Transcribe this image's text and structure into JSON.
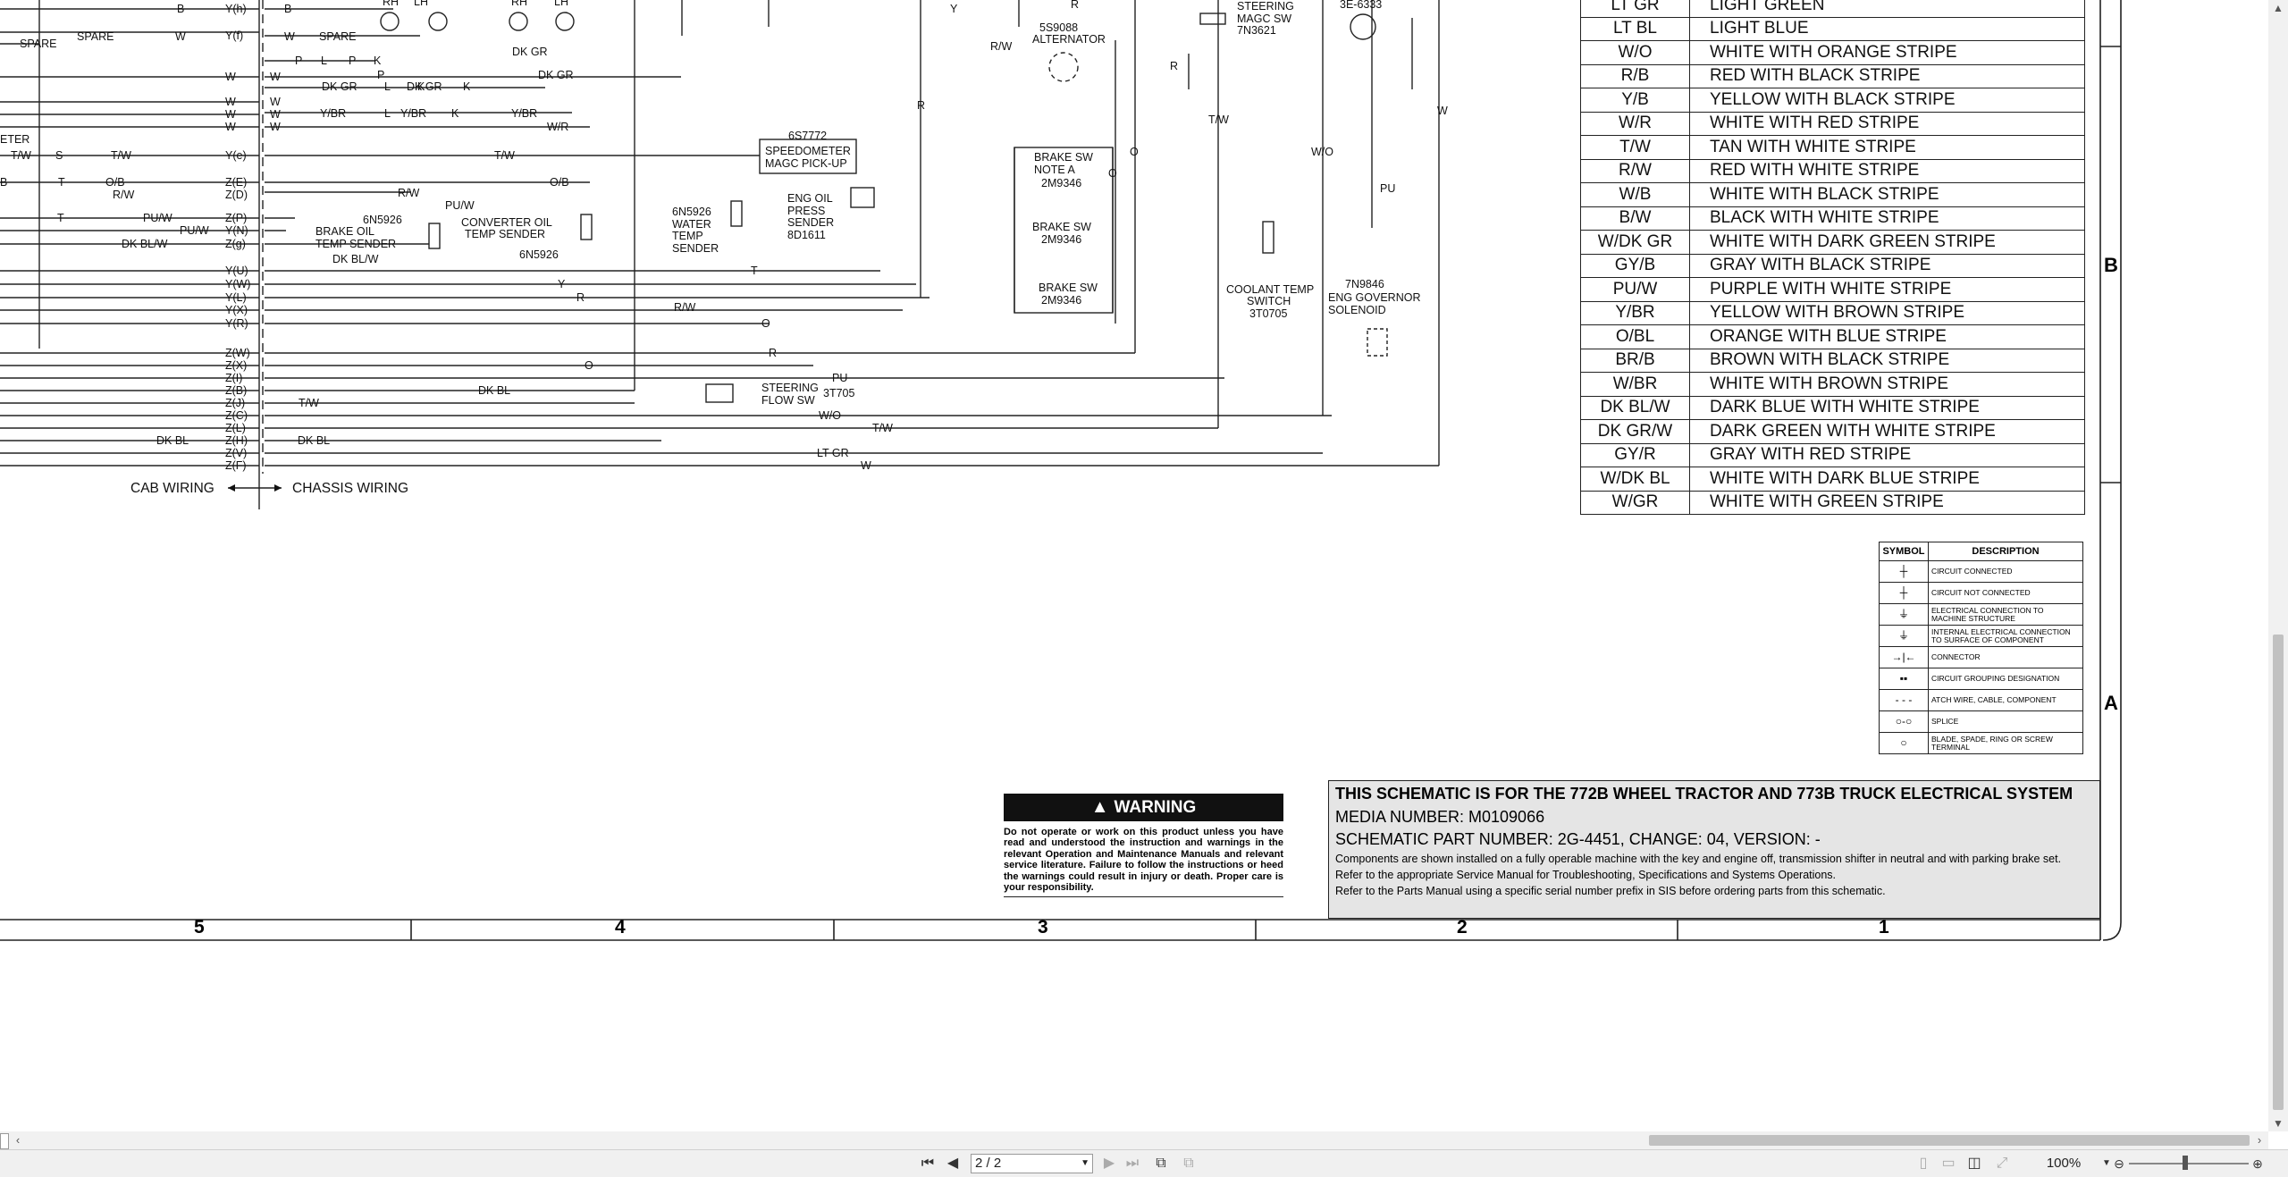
{
  "schematic": {
    "wire_labels": {
      "spare_a": "SPARE",
      "spare_b": "SPARE",
      "spare_c": "SPARE",
      "b1": "B",
      "b2": "B",
      "b3": "B",
      "w1": "W",
      "w2": "W",
      "w3": "W",
      "w4": "W",
      "w5": "W",
      "w6": "W",
      "w7": "W",
      "p1": "P",
      "p2": "P",
      "p3": "P",
      "l1": "L",
      "l2": "L",
      "l3": "L",
      "k1": "K",
      "k2": "K",
      "k3": "K",
      "k4": "K",
      "dkgr1": "DK GR",
      "dkgr2": "DK GR",
      "dkgr3": "DK GR",
      "dkgr4": "DK GR",
      "ybr1": "Y/BR",
      "ybr2": "Y/BR",
      "ybr3": "Y/BR",
      "wr1": "W/R",
      "eter": "ETER",
      "tw1": "T/W",
      "tw2": "T/W",
      "tw3": "T/W",
      "tw4": "T/W",
      "tw5": "T/W",
      "tw6": "T/W",
      "s1": "S",
      "t1": "T",
      "t2": "T",
      "t3": "T",
      "ob1": "O/B",
      "ob2": "O/B",
      "rw1": "R/W",
      "rw2": "R/W",
      "rw3": "R/W",
      "rw4": "R/W",
      "puw1": "PU/W",
      "puw2": "PU/W",
      "puw3": "PU/W",
      "dkblw1": "DK BL/W",
      "dkblw2": "DK BL/W",
      "y1": "Y",
      "y2": "Y",
      "r1": "R",
      "r2": "R",
      "r3": "R",
      "r4": "R",
      "r5": "R",
      "o1": "O",
      "o2": "O",
      "o3": "O",
      "o4": "O",
      "dkbl1": "DK BL",
      "dkbl2": "DK BL",
      "dkbl3": "DK BL",
      "pu1": "PU",
      "pu2": "PU",
      "wo1": "W/O",
      "wo2": "W/O",
      "ltgr": "LT GR",
      "w8": "W",
      "rh1": "RH",
      "lh1": "LH",
      "rh2": "RH",
      "lh2": "LH",
      "cab": "CAB WIRING",
      "chassis": "CHASSIS WIRING"
    },
    "connector_pins": [
      "Y(h)",
      "Y(f)",
      "W",
      "W",
      "W",
      "W",
      "Y(e)",
      "Z(E)",
      "Z(D)",
      "Z(P)",
      "Y(N)",
      "Z(g)",
      "Y(U)",
      "Y(W)",
      "Y(L)",
      "Y(X)",
      "Y(R)",
      "Z(W)",
      "Z(X)",
      "Z(I)",
      "Z(B)",
      "Z(J)",
      "Z(C)",
      "Z(L)",
      "Z(H)",
      "Z(V)",
      "Z(F)"
    ],
    "components": {
      "speedometer_pn": "6S7772",
      "speedometer_l1": "SPEEDOMETER",
      "speedometer_l2": "MAGC PICK-UP",
      "brake_oil_pn": "6N5926",
      "brake_oil_l1": "BRAKE OIL",
      "brake_oil_l2": "TEMP SENDER",
      "converter_l1": "CONVERTER OIL",
      "converter_l2": "TEMP SENDER",
      "converter_pn": "6N5926",
      "water_pn": "6N5926",
      "water_l1": "WATER",
      "water_l2": "TEMP",
      "water_l3": "SENDER",
      "engoil_l1": "ENG OIL",
      "engoil_l2": "PRESS",
      "engoil_l3": "SENDER",
      "engoil_pn": "8D1611",
      "alternator_pn": "5S9088",
      "alternator_l1": "ALTERNATOR",
      "brakesw1_l1": "BRAKE SW",
      "brakesw1_l2": "NOTE A",
      "brakesw1_pn": "2M9346",
      "brakesw2_l1": "BRAKE SW",
      "brakesw2_pn": "2M9346",
      "brakesw3_l1": "BRAKE SW",
      "brakesw3_pn": "2M9346",
      "steering_magc_l1": "STEERING",
      "steering_magc_l2": "MAGC SW",
      "steering_magc_pn": "7N3621",
      "steering_flow_l1": "STEERING",
      "steering_flow_l2": "FLOW SW",
      "steering_flow_pn": "3T705",
      "coolant_l1": "COOLANT TEMP",
      "coolant_l2": "SWITCH",
      "coolant_pn": "3T0705",
      "governor_pn": "7N9846",
      "governor_l1": "ENG GOVERNOR",
      "governor_l2": "SOLENOID",
      "part_3e": "3E-6333"
    }
  },
  "color_table": [
    {
      "code": "LT GR",
      "desc": "LIGHT GREEN"
    },
    {
      "code": "LT BL",
      "desc": "LIGHT BLUE"
    },
    {
      "code": "W/O",
      "desc": "WHITE WITH ORANGE STRIPE"
    },
    {
      "code": "R/B",
      "desc": "RED WITH BLACK STRIPE"
    },
    {
      "code": "Y/B",
      "desc": "YELLOW WITH BLACK STRIPE"
    },
    {
      "code": "W/R",
      "desc": "WHITE WITH RED STRIPE"
    },
    {
      "code": "T/W",
      "desc": "TAN WITH WHITE STRIPE"
    },
    {
      "code": "R/W",
      "desc": "RED WITH WHITE STRIPE"
    },
    {
      "code": "W/B",
      "desc": "WHITE WITH BLACK STRIPE"
    },
    {
      "code": "B/W",
      "desc": "BLACK WITH WHITE STRIPE"
    },
    {
      "code": "W/DK GR",
      "desc": "WHITE WITH DARK GREEN STRIPE"
    },
    {
      "code": "GY/B",
      "desc": "GRAY WITH BLACK STRIPE"
    },
    {
      "code": "PU/W",
      "desc": "PURPLE WITH WHITE STRIPE"
    },
    {
      "code": "Y/BR",
      "desc": "YELLOW WITH BROWN STRIPE"
    },
    {
      "code": "O/BL",
      "desc": "ORANGE WITH BLUE STRIPE"
    },
    {
      "code": "BR/B",
      "desc": "BROWN WITH BLACK STRIPE"
    },
    {
      "code": "W/BR",
      "desc": "WHITE WITH BROWN STRIPE"
    },
    {
      "code": "DK BL/W",
      "desc": "DARK BLUE WITH WHITE STRIPE"
    },
    {
      "code": "DK GR/W",
      "desc": "DARK GREEN WITH WHITE STRIPE"
    },
    {
      "code": "GY/R",
      "desc": "GRAY WITH RED STRIPE"
    },
    {
      "code": "W/DK BL",
      "desc": "WHITE WITH DARK BLUE STRIPE"
    },
    {
      "code": "W/GR",
      "desc": "WHITE WITH GREEN STRIPE"
    }
  ],
  "symbol_table": {
    "header_symbol": "SYMBOL",
    "header_desc": "DESCRIPTION",
    "rows": [
      {
        "symbol": "┼",
        "icon": "circuit-connected-icon",
        "desc": "CIRCUIT CONNECTED"
      },
      {
        "symbol": "┼",
        "icon": "circuit-not-connected-icon",
        "desc": "CIRCUIT NOT CONNECTED"
      },
      {
        "symbol": "⏚",
        "icon": "machine-ground-icon",
        "desc": "ELECTRICAL CONNECTION TO MACHINE STRUCTURE"
      },
      {
        "symbol": "⏚",
        "icon": "component-ground-icon",
        "desc": "INTERNAL ELECTRICAL CONNECTION TO SURFACE OF COMPONENT"
      },
      {
        "symbol": "→|←",
        "icon": "connector-icon",
        "desc": "CONNECTOR"
      },
      {
        "symbol": "▪▪",
        "icon": "circuit-grouping-icon",
        "desc": "CIRCUIT GROUPING DESIGNATION"
      },
      {
        "symbol": "- - -",
        "icon": "dashed-line-icon",
        "desc": "ATCH WIRE, CABLE, COMPONENT"
      },
      {
        "symbol": "○-○",
        "icon": "splice-icon",
        "desc": "SPLICE"
      },
      {
        "symbol": "○",
        "icon": "terminal-icon",
        "desc": "BLADE, SPADE, RING OR SCREW TERMINAL"
      }
    ]
  },
  "title_block": {
    "title": "THIS SCHEMATIC IS FOR THE 772B WHEEL TRACTOR AND 773B TRUCK ELECTRICAL SYSTEM",
    "media": "MEDIA NUMBER: M0109066",
    "part": "SCHEMATIC PART NUMBER: 2G-4451, CHANGE: 04, VERSION: -",
    "note1": "Components are shown installed on a fully operable machine with the key and engine off, transmission shifter in neutral and with parking brake set.",
    "note2": "Refer to the appropriate Service Manual for Troubleshooting, Specifications and Systems Operations.",
    "note3": "Refer to the Parts Manual using a specific serial number prefix in SIS before ordering parts from this schematic."
  },
  "warning": {
    "header": "WARNING",
    "icon": "warning-triangle-icon",
    "text": "Do not operate or work on this product unless you have read and understood the instruction and warnings in the relevant Operation and Maintenance Manuals and relevant service literature. Failure to follow the instructions or heed the warnings could result in injury or death. Proper care is your responsibility."
  },
  "zones": {
    "letter_b": "B",
    "letter_a": "A",
    "numbers": [
      "5",
      "4",
      "3",
      "2",
      "1"
    ]
  },
  "viewer": {
    "page_field": "2 / 2",
    "zoom": "100%",
    "zoom_fraction": 0.47
  }
}
